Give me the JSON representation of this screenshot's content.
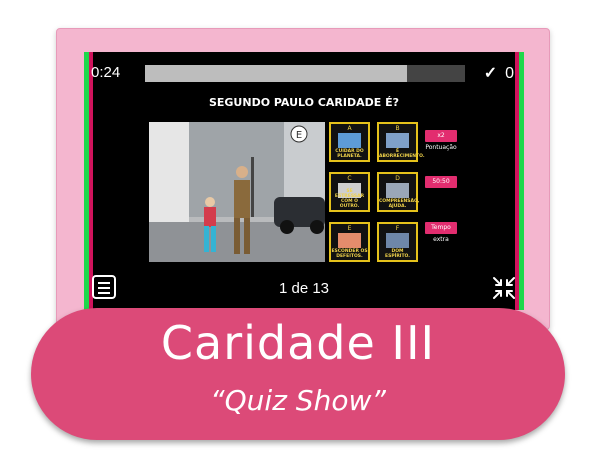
{
  "game": {
    "timer": "0:24",
    "progress": 0.82,
    "score": "0",
    "question": "SEGUNDO PAULO CARIDADE É?",
    "counter": "1 de 13"
  },
  "answers": [
    {
      "letter": "A",
      "label": "CUIDAR DO PLANETA."
    },
    {
      "letter": "B",
      "label": "É ABORRECIMENTO."
    },
    {
      "letter": "C",
      "label": "SE ESTRESSAR COM O OUTRO."
    },
    {
      "letter": "D",
      "label": "COMPREENSÃO, AJUDA."
    },
    {
      "letter": "E",
      "label": "ESCONDER OS DEFEITOS."
    },
    {
      "letter": "F",
      "label": "DOM ESPÍRITO."
    }
  ],
  "lifelines": [
    "x2 Pontuação",
    "50:50",
    "Tempo extra"
  ],
  "banner": {
    "title": "Caridade III",
    "subtitle": "“Quiz Show”"
  },
  "colors": {
    "frame": "#f4b6cf",
    "banner": "#dc4a78",
    "accent_green": "#1dd84b",
    "accent_magenta": "#d0135c",
    "card_border": "#e5c21b"
  }
}
